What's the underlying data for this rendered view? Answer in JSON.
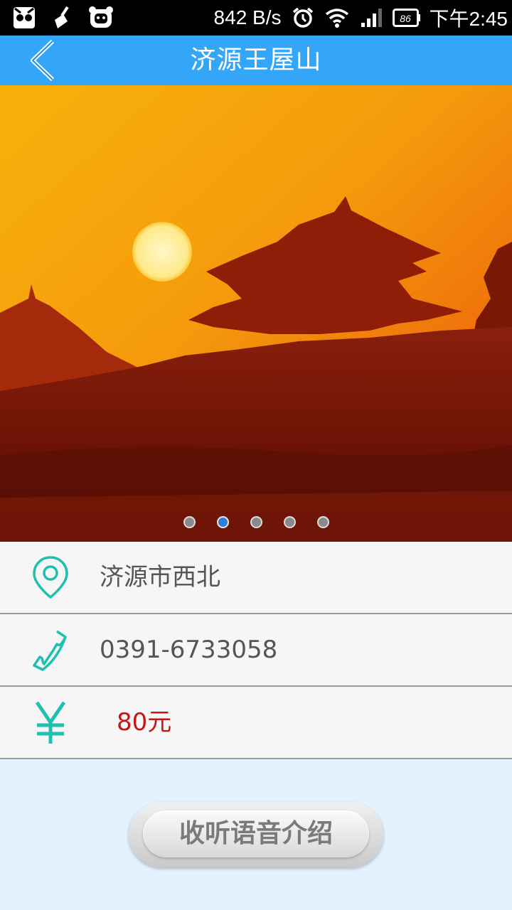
{
  "status_bar": {
    "network_speed": "842 B/s",
    "battery": "86",
    "time": "下午2:45"
  },
  "header": {
    "title": "济源王屋山"
  },
  "carousel": {
    "total_slides": 5,
    "active_index": 1
  },
  "info": {
    "address": "济源市西北",
    "phone": "0391-6733058",
    "price": "80元"
  },
  "actions": {
    "audio_label": "收听语音介绍"
  },
  "colors": {
    "title_bar": "#33a6f7",
    "icon_teal": "#20c0b0",
    "price_red": "#c81414",
    "page_bg": "#e3f2fe"
  }
}
